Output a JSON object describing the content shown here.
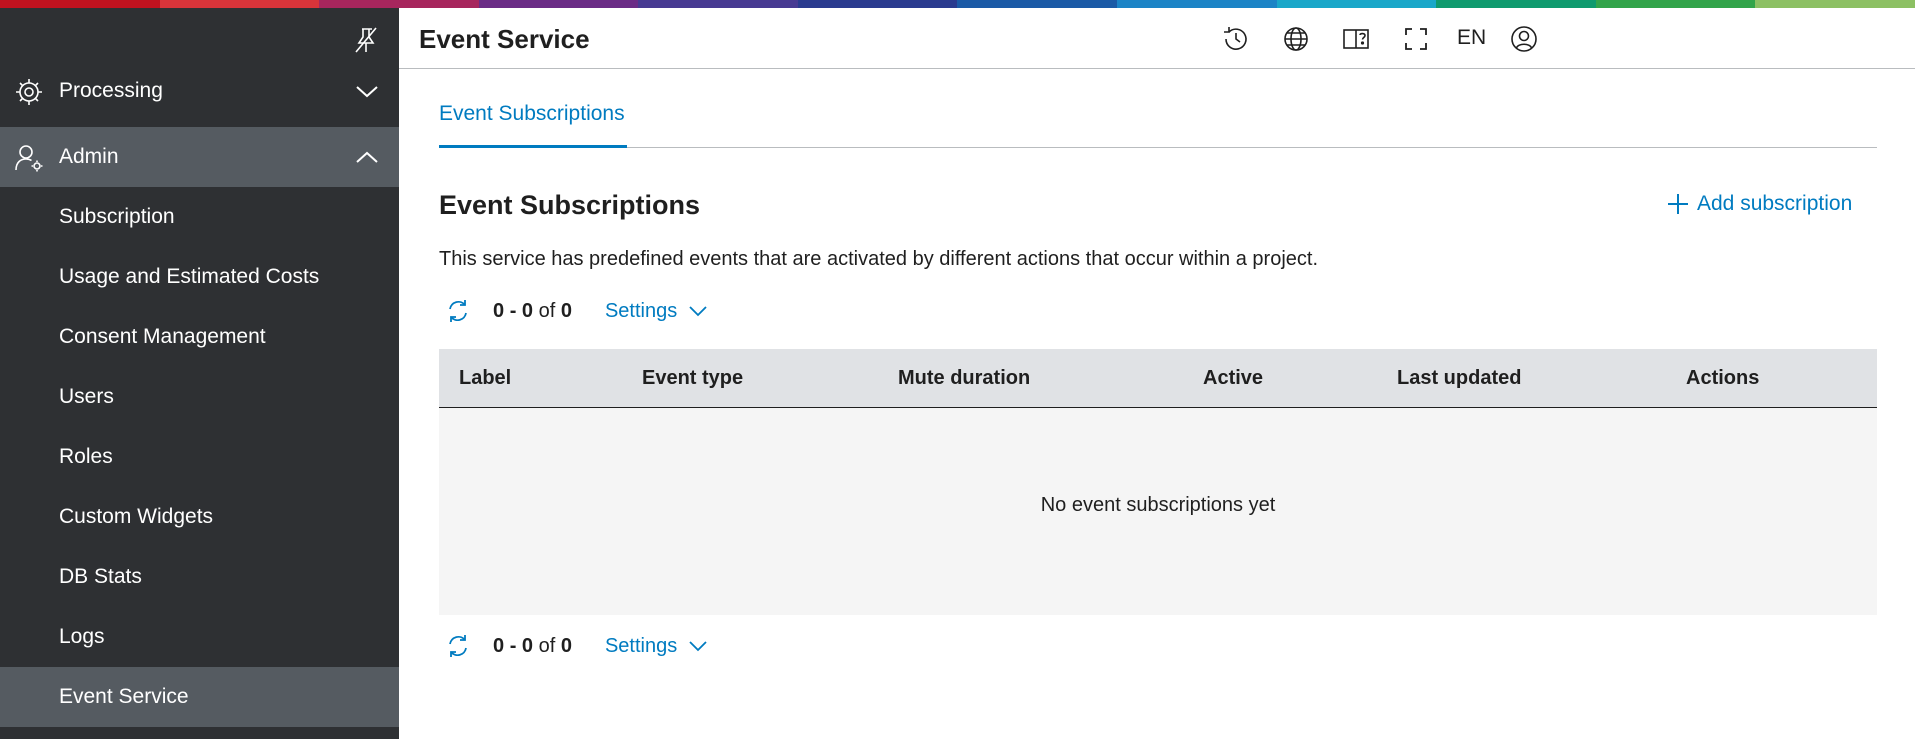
{
  "brand": {
    "stripe_colors": [
      "#c1121f",
      "#d9343a",
      "#a7265d",
      "#6b2c86",
      "#473a92",
      "#2a3b8f",
      "#1b5aa6",
      "#1c84c6",
      "#1aa7c9",
      "#0f9a6e",
      "#32a44a",
      "#8cc063"
    ]
  },
  "colors": {
    "accent": "#007bc0",
    "sidebar_bg": "#2e3033",
    "sidebar_active": "#555b61"
  },
  "sidebar": {
    "pin_icon": "unpin-icon",
    "groups": [
      {
        "label": "Processing",
        "icon": "processing-gear-icon",
        "expanded": false
      },
      {
        "label": "Admin",
        "icon": "admin-user-gear-icon",
        "expanded": true
      }
    ],
    "admin_items": [
      {
        "label": "Subscription"
      },
      {
        "label": "Usage and Estimated Costs"
      },
      {
        "label": "Consent Management"
      },
      {
        "label": "Users"
      },
      {
        "label": "Roles"
      },
      {
        "label": "Custom Widgets"
      },
      {
        "label": "DB Stats"
      },
      {
        "label": "Logs"
      },
      {
        "label": "Event Service",
        "selected": true
      }
    ]
  },
  "header": {
    "title": "Event Service",
    "icons": [
      "history-icon",
      "globe-icon",
      "help-book-icon",
      "fullscreen-icon",
      "user-profile-icon"
    ],
    "language": "EN"
  },
  "tabs": [
    {
      "label": "Event Subscriptions",
      "active": true
    }
  ],
  "section": {
    "title": "Event Subscriptions",
    "add_label": "Add subscription",
    "description": "This service has predefined events that are activated by different actions that occur within a project."
  },
  "pager": {
    "from": "0",
    "to": "0",
    "of_label": "of",
    "total": "0",
    "settings_label": "Settings"
  },
  "table": {
    "columns": [
      "Label",
      "Event type",
      "Mute duration",
      "Active",
      "Last updated",
      "Actions"
    ],
    "empty_message": "No event subscriptions yet"
  }
}
